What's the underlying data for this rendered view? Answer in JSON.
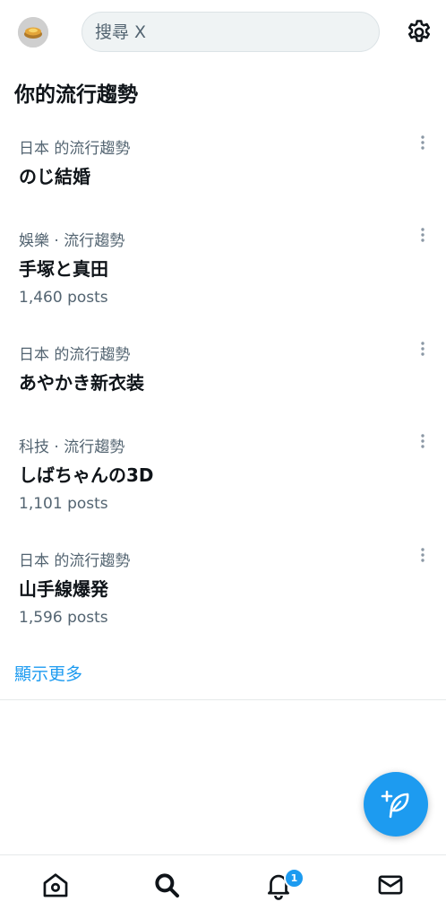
{
  "header": {
    "search_placeholder": "搜尋 X"
  },
  "section": {
    "title": "你的流行趨勢"
  },
  "trends": [
    {
      "meta": "日本 的流行趨勢",
      "name": "のじ結婚",
      "count": ""
    },
    {
      "meta": "娛樂 · 流行趨勢",
      "name": "手塚と真田",
      "count": "1,460 posts"
    },
    {
      "meta": "日本 的流行趨勢",
      "name": "あやかき新衣装",
      "count": ""
    },
    {
      "meta": "科技 · 流行趨勢",
      "name": "しばちゃんの3D",
      "count": "1,101 posts"
    },
    {
      "meta": "日本 的流行趨勢",
      "name": "山手線爆発",
      "count": "1,596 posts"
    }
  ],
  "show_more": "顯示更多",
  "notifications": {
    "badge": "1"
  },
  "icons": {
    "settings": "gear-icon",
    "more": "more-vertical-icon",
    "compose": "feather-plus-icon",
    "home": "home-icon",
    "search": "search-icon",
    "notifications": "bell-icon",
    "messages": "mail-icon"
  },
  "colors": {
    "accent": "#1d9bf0",
    "text_primary": "#0f1419",
    "text_secondary": "#536471",
    "search_bg": "#eff3f4"
  }
}
